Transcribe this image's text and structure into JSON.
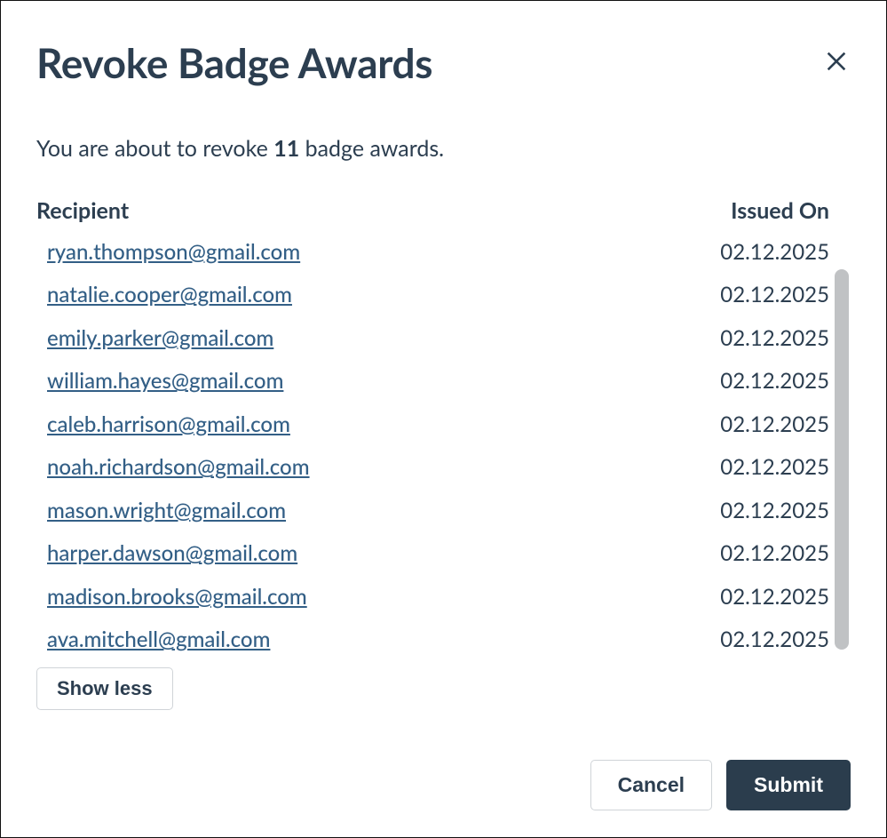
{
  "dialog": {
    "title": "Revoke Badge Awards",
    "confirm_prefix": "You are about to revoke ",
    "confirm_count": "11",
    "confirm_suffix": " badge awards.",
    "headers": {
      "recipient": "Recipient",
      "issued_on": "Issued On"
    },
    "rows": [
      {
        "email": "ryan.thompson@gmail.com",
        "issued": "02.12.2025"
      },
      {
        "email": "natalie.cooper@gmail.com",
        "issued": "02.12.2025"
      },
      {
        "email": "emily.parker@gmail.com",
        "issued": "02.12.2025"
      },
      {
        "email": "william.hayes@gmail.com",
        "issued": "02.12.2025"
      },
      {
        "email": "caleb.harrison@gmail.com",
        "issued": "02.12.2025"
      },
      {
        "email": "noah.richardson@gmail.com",
        "issued": "02.12.2025"
      },
      {
        "email": "mason.wright@gmail.com",
        "issued": "02.12.2025"
      },
      {
        "email": "harper.dawson@gmail.com",
        "issued": "02.12.2025"
      },
      {
        "email": "madison.brooks@gmail.com",
        "issued": "02.12.2025"
      },
      {
        "email": "ava.mitchell@gmail.com",
        "issued": "02.12.2025"
      }
    ],
    "show_less_label": "Show less",
    "cancel_label": "Cancel",
    "submit_label": "Submit"
  }
}
